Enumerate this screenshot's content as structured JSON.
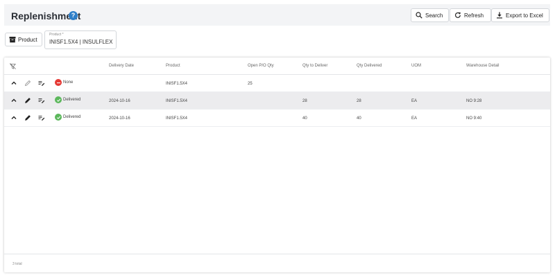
{
  "header": {
    "title": "Replenishment",
    "help_icon": "help-circle-icon",
    "buttons": {
      "search": "Search",
      "refresh": "Refresh",
      "export": "Export to Excel"
    }
  },
  "filter": {
    "product_button": "Product",
    "product_field_label": "Product *",
    "product_field_value": "INISF1.5X4 | INSULFLEX"
  },
  "grid": {
    "columns": [
      "Delivery Date",
      "Product",
      "Open P/O Qty",
      "Qty to Deliver",
      "Qty Delivered",
      "UOM",
      "Warehouse Detail"
    ],
    "rows": [
      {
        "status": "None",
        "status_color": "#e53935",
        "delivery_date": "",
        "product": "INISF1.5X4",
        "open_po_qty": "25",
        "qty_to_deliver": "",
        "qty_delivered": "",
        "uom": "",
        "warehouse_detail": ""
      },
      {
        "status": "Delivered",
        "status_color": "#5cb85c",
        "delivery_date": "2024-10-16",
        "product": "INISF1.5X4",
        "open_po_qty": "",
        "qty_to_deliver": "28",
        "qty_delivered": "28",
        "uom": "EA",
        "warehouse_detail": "NO 9:28"
      },
      {
        "status": "Delivered",
        "status_color": "#5cb85c",
        "delivery_date": "2024-10-16",
        "product": "INISF1.5X4",
        "open_po_qty": "",
        "qty_to_deliver": "40",
        "qty_delivered": "40",
        "uom": "EA",
        "warehouse_detail": "NO 9:40"
      }
    ],
    "footer_total": "3 total"
  },
  "colors": {
    "accent": "#2f7fc8",
    "status_none": "#e53935",
    "status_delivered": "#5cb85c"
  }
}
